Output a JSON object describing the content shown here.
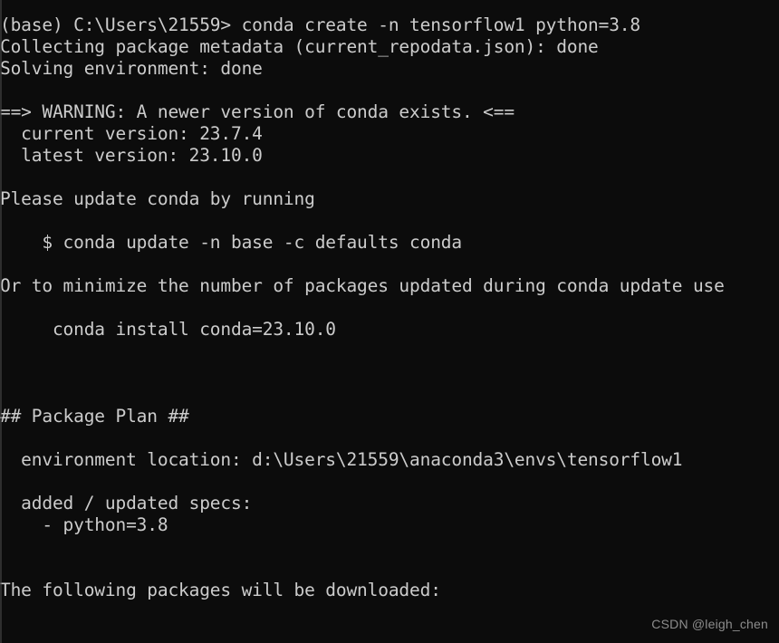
{
  "window": {
    "app": "Windows Command Prompt",
    "background_color": "#0c0c0c",
    "text_color": "#cccccc",
    "watermark_color": "#8d8d8d"
  },
  "terminal": {
    "prompt": "(base) C:\\Users\\21559>",
    "command": "conda create -n tensorflow1 python=3.8",
    "lines": [
      "(base) C:\\Users\\21559> conda create -n tensorflow1 python=3.8",
      "Collecting package metadata (current_repodata.json): done",
      "Solving environment: done",
      "",
      "==> WARNING: A newer version of conda exists. <==",
      "  current version: 23.7.4",
      "  latest version: 23.10.0",
      "",
      "Please update conda by running",
      "",
      "    $ conda update -n base -c defaults conda",
      "",
      "Or to minimize the number of packages updated during conda update use",
      "",
      "     conda install conda=23.10.0",
      "",
      "",
      "",
      "## Package Plan ##",
      "",
      "  environment location: d:\\Users\\21559\\anaconda3\\envs\\tensorflow1",
      "",
      "  added / updated specs:",
      "    - python=3.8",
      "",
      "",
      "The following packages will be downloaded:"
    ],
    "details": {
      "warning_title": "==> WARNING: A newer version of conda exists. <==",
      "current_version": "23.7.4",
      "latest_version": "23.10.0",
      "update_command": "$ conda update -n base -c defaults conda",
      "install_command": "conda install conda=23.10.0",
      "package_plan_header": "## Package Plan ##",
      "environment_location": "d:\\Users\\21559\\anaconda3\\envs\\tensorflow1",
      "added_updated_specs_label": "added / updated specs:",
      "spec_item": "- python=3.8",
      "download_notice": "The following packages will be downloaded:"
    }
  },
  "watermark": {
    "text": "CSDN @leigh_chen"
  }
}
